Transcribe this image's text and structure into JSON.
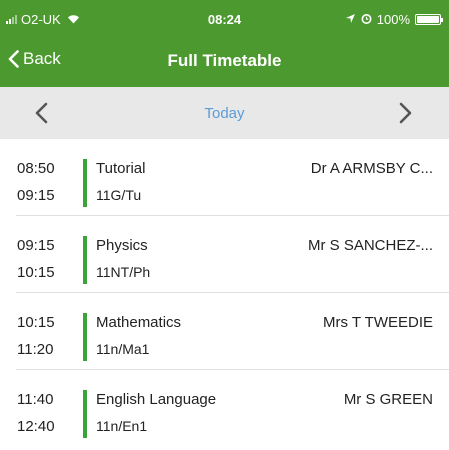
{
  "status_bar": {
    "carrier": "O2-UK",
    "time": "08:24",
    "battery_percent": "100%",
    "battery_level": 1.0,
    "icons": [
      "signal-icon",
      "wifi-icon",
      "location-icon",
      "alarm-icon",
      "battery-icon"
    ]
  },
  "nav": {
    "back_label": "Back",
    "title": "Full Timetable"
  },
  "date_bar": {
    "label": "Today"
  },
  "colors": {
    "header_bg": "#4c9a2f",
    "accent_blue": "#5b9bd8",
    "period_bar": "#3aa33a",
    "date_bar_bg": "#e8e8e8"
  },
  "lessons": [
    {
      "start": "08:50",
      "end": "09:15",
      "subject": "Tutorial",
      "group": "11G/Tu",
      "teacher": "Dr A ARMSBY C..."
    },
    {
      "start": "09:15",
      "end": "10:15",
      "subject": "Physics",
      "group": "11NT/Ph",
      "teacher": "Mr S SANCHEZ-..."
    },
    {
      "start": "10:15",
      "end": "11:20",
      "subject": "Mathematics",
      "group": "11n/Ma1",
      "teacher": "Mrs T TWEEDIE"
    },
    {
      "start": "11:40",
      "end": "12:40",
      "subject": "English Language",
      "group": "11n/En1",
      "teacher": "Mr S GREEN"
    }
  ]
}
